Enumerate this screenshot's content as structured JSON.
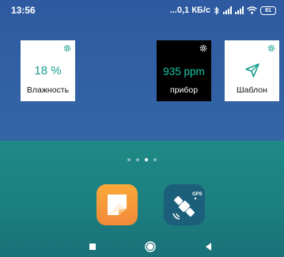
{
  "status_bar": {
    "time": "13:56",
    "net_speed": "...0,1 КБ/с",
    "battery": "81",
    "icons": [
      "bluetooth-icon",
      "signal-icon",
      "signal-icon",
      "wifi-icon",
      "battery-icon"
    ]
  },
  "widgets": {
    "humidity": {
      "value": "18 %",
      "label": "Влажность",
      "icon": "gear-icon"
    },
    "device": {
      "value": "935 ppm",
      "label": "прибор",
      "icon": "gear-icon"
    },
    "template": {
      "label": "Шаблон",
      "icon": "send-icon"
    }
  },
  "pager": {
    "pages": 4,
    "active_page": 3
  },
  "dock": {
    "apps": [
      {
        "name": "notes-app",
        "icon": "notes-icon",
        "color": "#f39a3a"
      },
      {
        "name": "gps-app",
        "icon": "gps-satellite-icon",
        "badge": "GPS",
        "color": "#1c5f7a"
      }
    ]
  },
  "nav_bar": {
    "buttons": [
      "recent-apps",
      "home",
      "back"
    ]
  },
  "colors": {
    "upper_bg": "#2d5ca1",
    "lower_bg": "#1e8a86",
    "accent_teal": "#199e8d",
    "device_text": "#17c8a4"
  }
}
